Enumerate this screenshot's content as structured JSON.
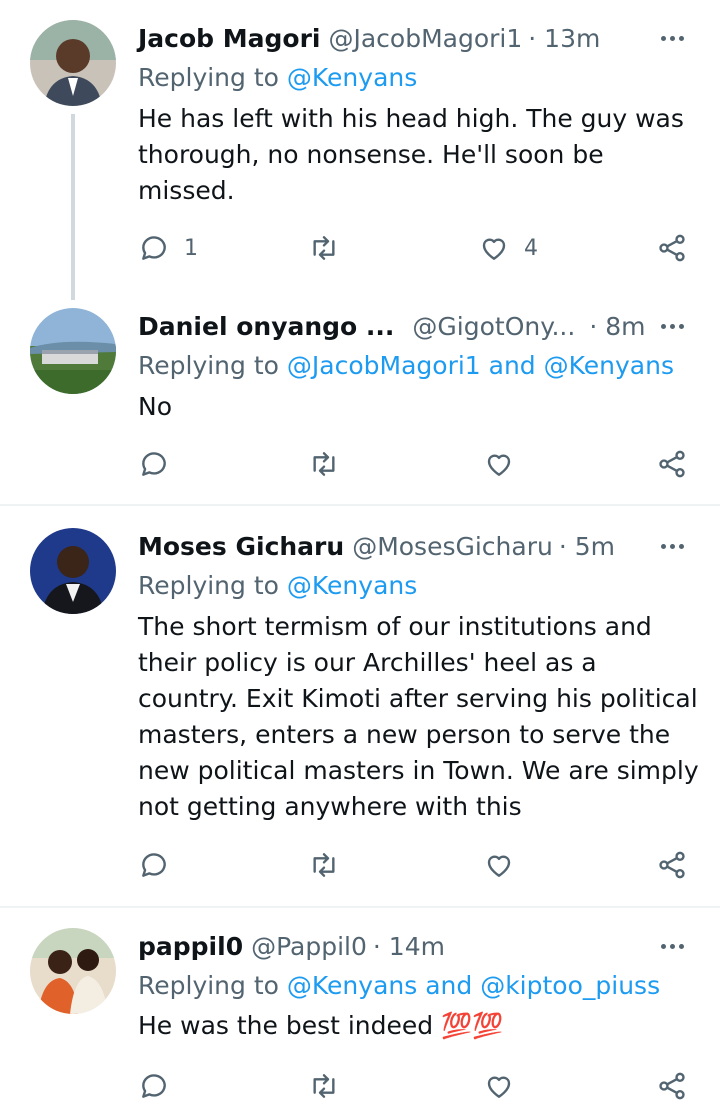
{
  "tweets": [
    {
      "name": "Jacob Magori",
      "handle": "@JacobMagori1",
      "time": "· 13m",
      "reply_prefix": "Replying to",
      "reply_to": "@Kenyans",
      "text": "He has left with his head high. The guy was thorough, no nonsense. He'll soon be missed.",
      "reply_count": "1",
      "like_count": "4"
    },
    {
      "name": "Daniel onyango ...",
      "handle": "@GigotOny...",
      "time": "· 8m",
      "reply_prefix": "Replying to",
      "reply_to": "@JacobMagori1 and @Kenyans",
      "text": "No",
      "reply_count": "",
      "like_count": ""
    },
    {
      "name": "Moses Gicharu",
      "handle": "@MosesGicharu",
      "time": "· 5m",
      "reply_prefix": "Replying to",
      "reply_to": "@Kenyans",
      "text": "The short termism of our institutions and their policy is our Archilles' heel as a country. Exit Kimoti after serving his political masters, enters a new person to serve the new political masters in Town. We are simply not getting anywhere with this",
      "reply_count": "",
      "like_count": ""
    },
    {
      "name": "pappil0",
      "handle": "@Pappil0",
      "time": "· 14m",
      "reply_prefix": "Replying to",
      "reply_to": "@Kenyans and @kiptoo_piuss",
      "text": "He was the best indeed 💯💯",
      "reply_count": "",
      "like_count": ""
    }
  ],
  "icons": {
    "reply": "reply-icon",
    "retweet": "retweet-icon",
    "like": "heart-icon",
    "share": "share-icon",
    "more": "more-icon"
  },
  "colors": {
    "link": "#1d9bf0",
    "secondary": "#536471",
    "text": "#0f1419",
    "separator": "#eff3f4"
  }
}
